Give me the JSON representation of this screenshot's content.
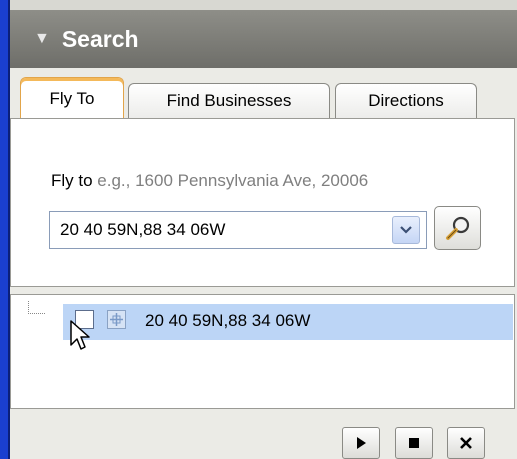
{
  "panel": {
    "title": "Search"
  },
  "tabs": [
    {
      "label": "Fly To",
      "active": true
    },
    {
      "label": "Find Businesses",
      "active": false
    },
    {
      "label": "Directions",
      "active": false
    }
  ],
  "fly_to": {
    "label": "Fly to",
    "hint": "e.g., 1600 Pennsylvania Ave, 20006",
    "value": "20 40 59N,88 34 06W"
  },
  "results": [
    {
      "label": "20 40 59N,88 34 06W",
      "checked": false
    }
  ],
  "icons": {
    "collapse": "triangle-down-icon",
    "search": "magnifier-icon",
    "dropdown": "chevron-down-icon",
    "play": "play-icon",
    "stop": "stop-icon",
    "close": "close-icon"
  },
  "colors": {
    "accent_left": "#1a3fd0",
    "selection": "#bcd5f6",
    "active_tab": "#f4b95a"
  }
}
